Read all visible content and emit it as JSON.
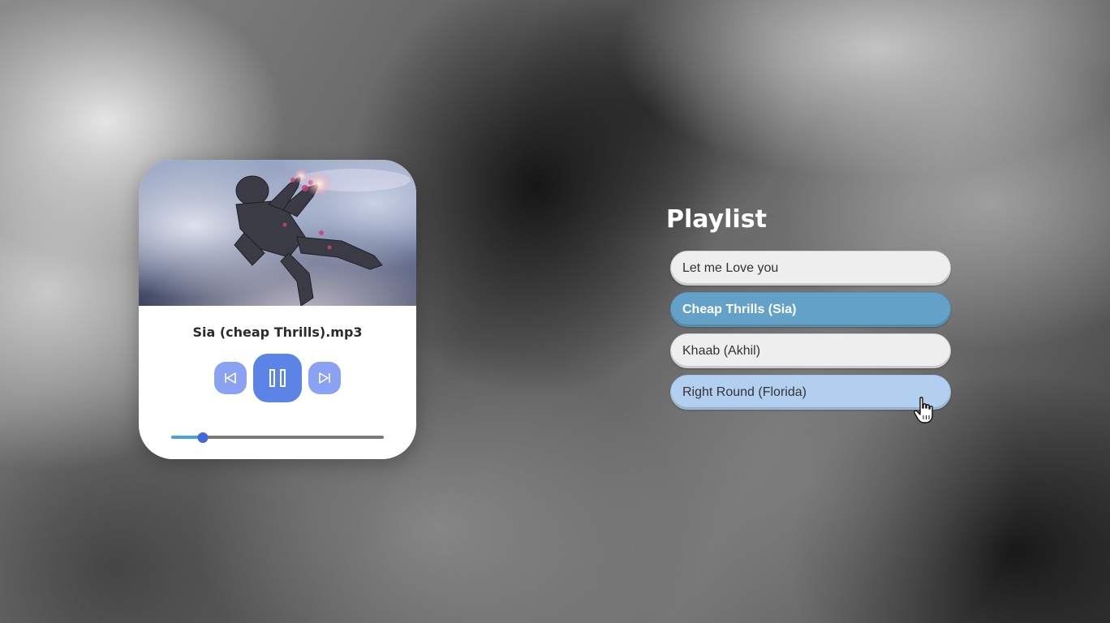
{
  "colors": {
    "card_background": "#ffffff",
    "accent_blue": "#5c83e6",
    "accent_light_blue": "#8aa2f1",
    "progress_fill": "#4aa3e0",
    "active_item": "#63a1c8",
    "hover_item": "#b3cff0",
    "item_default": "#eeeeee"
  },
  "player": {
    "track_title": "Sia (cheap Thrills).mp3",
    "cover_icon": "album-art-image",
    "prev_icon": "skip-previous-icon",
    "main_icon": "pause-icon",
    "next_icon": "skip-next-icon",
    "progress_fraction": 0.15
  },
  "playlist": {
    "title": "Playlist",
    "items": [
      {
        "label": "Let me Love you",
        "state": "default"
      },
      {
        "label": "Cheap Thrills (Sia)",
        "state": "active"
      },
      {
        "label": "Khaab (Akhil)",
        "state": "default"
      },
      {
        "label": "Right Round (Florida)",
        "state": "hover"
      }
    ]
  },
  "cursor_icon": "hand-pointer-icon"
}
